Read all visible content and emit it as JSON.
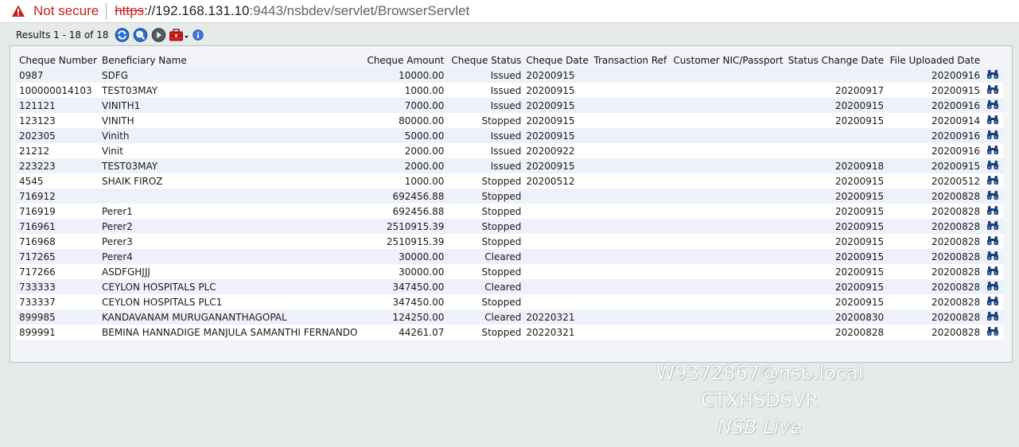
{
  "browser": {
    "security_label": "Not secure",
    "url_scheme": "https",
    "url_host": "://192.168.131.10",
    "url_rest": ":9443/nsbdev/servlet/BrowserServlet"
  },
  "toolbar": {
    "results_text": "Results 1 - 18 of 18",
    "icons": [
      "refresh-icon",
      "search-icon",
      "next-icon",
      "tools-menu-icon",
      "info-icon"
    ]
  },
  "table": {
    "headers": [
      "Cheque Number",
      "Beneficiary Name",
      "Cheque Amount",
      "Cheque Status",
      "Cheque Date",
      "Transaction Ref",
      "Customer NIC/Passport",
      "Status Change Date",
      "File Uploaded Date"
    ],
    "rows": [
      [
        "0987",
        "SDFG",
        "10000.00",
        "Issued",
        "20200915",
        "",
        "",
        "",
        "20200916"
      ],
      [
        "100000014103",
        "TEST03MAY",
        "1000.00",
        "Issued",
        "20200915",
        "",
        "",
        "20200917",
        "20200915"
      ],
      [
        "121121",
        "VINITH1",
        "7000.00",
        "Issued",
        "20200915",
        "",
        "",
        "20200915",
        "20200916"
      ],
      [
        "123123",
        "VINITH",
        "80000.00",
        "Stopped",
        "20200915",
        "",
        "",
        "20200915",
        "20200914"
      ],
      [
        "202305",
        "Vinith",
        "5000.00",
        "Issued",
        "20200915",
        "",
        "",
        "",
        "20200916"
      ],
      [
        "21212",
        "Vinit",
        "2000.00",
        "Issued",
        "20200922",
        "",
        "",
        "",
        "20200916"
      ],
      [
        "223223",
        "TEST03MAY",
        "2000.00",
        "Issued",
        "20200915",
        "",
        "",
        "20200918",
        "20200915"
      ],
      [
        "4545",
        "SHAIK FIROZ",
        "1000.00",
        "Stopped",
        "20200512",
        "",
        "",
        "20200915",
        "20200512"
      ],
      [
        "716912",
        "",
        "692456.88",
        "Stopped",
        "",
        "",
        "",
        "20200915",
        "20200828"
      ],
      [
        "716919",
        "Perer1",
        "692456.88",
        "Stopped",
        "",
        "",
        "",
        "20200915",
        "20200828"
      ],
      [
        "716961",
        "Perer2",
        "2510915.39",
        "Stopped",
        "",
        "",
        "",
        "20200915",
        "20200828"
      ],
      [
        "716968",
        "Perer3",
        "2510915.39",
        "Stopped",
        "",
        "",
        "",
        "20200915",
        "20200828"
      ],
      [
        "717265",
        "Perer4",
        "30000.00",
        "Cleared",
        "",
        "",
        "",
        "20200915",
        "20200828"
      ],
      [
        "717266",
        "ASDFGHJJJ",
        "30000.00",
        "Stopped",
        "",
        "",
        "",
        "20200915",
        "20200828"
      ],
      [
        "733333",
        "CEYLON HOSPITALS PLC",
        "347450.00",
        "Cleared",
        "",
        "",
        "",
        "20200915",
        "20200828"
      ],
      [
        "733337",
        "CEYLON HOSPITALS PLC1",
        "347450.00",
        "Stopped",
        "",
        "",
        "",
        "20200915",
        "20200828"
      ],
      [
        "899985",
        "KANDAVANAM MURUGANANTHAGOPAL",
        "124250.00",
        "Cleared",
        "20220321",
        "",
        "",
        "20200830",
        "20200828"
      ],
      [
        "899991",
        "BEMINA HANNADIGE MANJULA SAMANTHI FERNANDO",
        "44261.07",
        "Stopped",
        "20220321",
        "",
        "",
        "20200828",
        "20200828"
      ]
    ],
    "row_action_icon": "binoculars-icon"
  },
  "watermark": {
    "line1": "W9372867@nsb.local",
    "line2": "CTXHSDSVR",
    "line3": "NSB Live"
  },
  "colors": {
    "not_secure": "#c5221f",
    "row_alt": "#eef1fa",
    "panel_bg": "#f2f4f7",
    "page_bg": "#e6ebe9",
    "icon_blue": "#1b4f9c"
  }
}
